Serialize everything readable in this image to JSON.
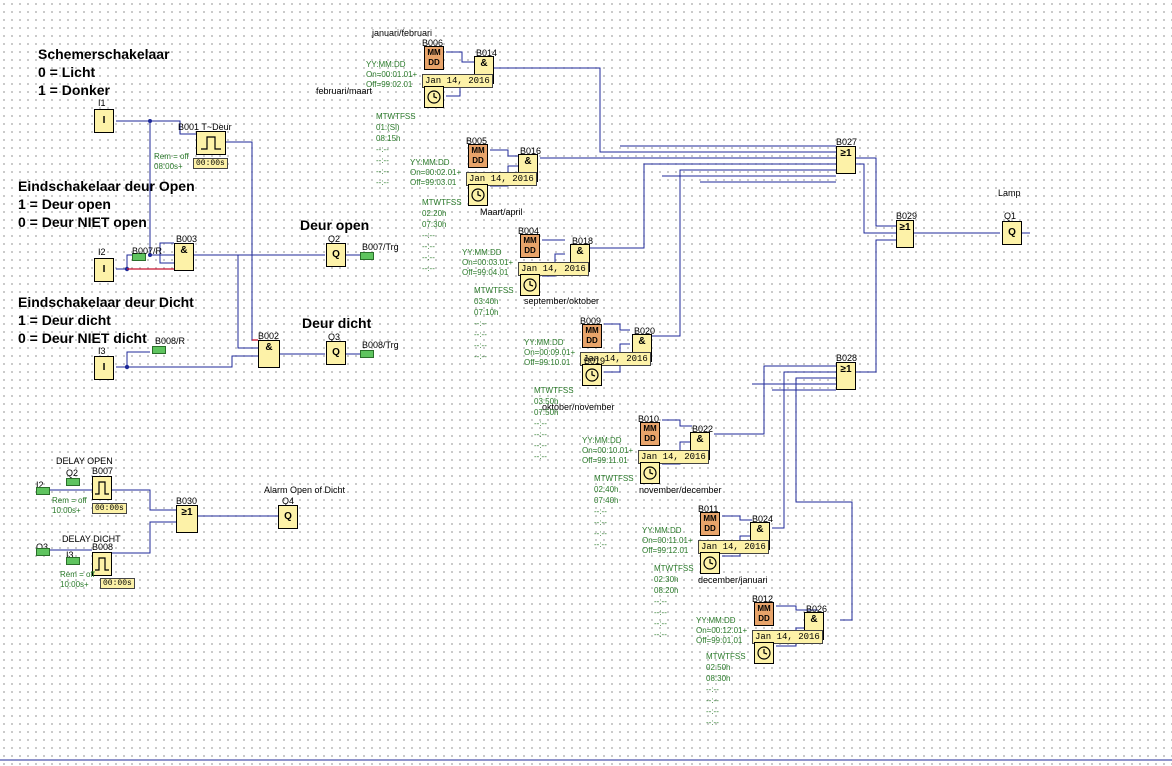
{
  "labels": {
    "schemer_title": "Schemerschakelaar",
    "schemer_0": "0 = Licht",
    "schemer_1": "1 = Donker",
    "open_title": "Eindschakelaar deur Open",
    "open_1": "1 = Deur open",
    "open_0": "0 = Deur NIET open",
    "dicht_title": "Eindschakelaar deur Dicht",
    "dicht_1": "1 = Deur dicht",
    "dicht_0": "0 = Deur NIET dicht",
    "deur_open": "Deur open",
    "deur_dicht": "Deur dicht",
    "delay_open": "DELAY OPEN",
    "delay_dicht": "DELAY DICHT",
    "alarm": "Alarm Open of Dicht",
    "lamp": "Lamp"
  },
  "blocks": {
    "i1": "I1",
    "i2": "I2",
    "i3": "I3",
    "q1": "Q1",
    "q2": "Q2",
    "q3": "Q3",
    "q4": "Q4",
    "b001": "B001 T~Deur",
    "b003": "B003",
    "b002": "B002",
    "b007r": "B007/R",
    "b008r": "B008/R",
    "b007trg": "B007/Trg",
    "b008trg": "B008/Trg",
    "b007": "B007",
    "b008": "B008",
    "b030": "B030",
    "b027": "B027",
    "b028": "B028",
    "b029": "B029",
    "q2_small": "Q2",
    "q3_small": "Q3",
    "i2_small": "I2",
    "i3_small": "I3"
  },
  "symbols": {
    "and": "&",
    "or": "≥1",
    "q": "Q",
    "i": "I",
    "mm": "MM",
    "dd": "DD"
  },
  "rem": {
    "b001": [
      "Rem = off",
      "08:00s+"
    ],
    "b007": [
      "Rem = off",
      "10:00s+"
    ],
    "b008": [
      "Rem = off",
      "10:00s+"
    ],
    "b001_time": "00:00s",
    "b007_time": "00:00s",
    "b008_time": "00:00s"
  },
  "months": [
    {
      "name": "januari/februari",
      "mm": "B006",
      "and": "B014",
      "fmt": "YY:MM:DD",
      "on": "On=00:01.01+",
      "off": "Off=99:02.01",
      "date": "Jan 14, 2016",
      "timer_title": "februari/maart",
      "timer": [
        "MTWTFSS",
        "01:(Sl)",
        "08:15h",
        "--:--",
        "--:--",
        "--:--",
        "--:--"
      ]
    },
    {
      "name": "",
      "mm": "B005",
      "and": "B016",
      "fmt": "YY:MM:DD",
      "on": "On=00:02.01+",
      "off": "Off=99:03.01",
      "date": "Jan 14, 2016",
      "timer_title": "Maart/april",
      "timer": [
        "MTWTFSS",
        "02:20h",
        "07:30h",
        "--:--",
        "--:--",
        "--:--",
        "--:--"
      ]
    },
    {
      "name": "",
      "mm": "B004",
      "and": "B018",
      "fmt": "YY:MM:DD",
      "on": "On=00:03.01+",
      "off": "Off=99:04.01",
      "date": "Jan 14, 2016",
      "timer_title": "september/oktober",
      "timer": [
        "MTWTFSS",
        "03:40h",
        "07:10h",
        "--:--",
        "--:--",
        "--:--",
        "--:--"
      ]
    },
    {
      "name": "",
      "mm": "B009",
      "and": "B020",
      "fmt": "YY:MM:DD",
      "on": "On=00:09.01+",
      "off": "Off=99:10.01",
      "date": "Jan 14, 2016",
      "timer_title": "oktober/november",
      "timer": [
        "MTWTFSS",
        "03:50h",
        "07:50h",
        "--:--",
        "--:--",
        "--:--",
        "--:--"
      ],
      "clk_label": "B019"
    },
    {
      "name": "",
      "mm": "B010",
      "and": "B022",
      "fmt": "YY:MM:DD",
      "on": "On=00:10.01+",
      "off": "Off=99:11.01",
      "date": "Jan 14, 2016",
      "timer_title": "november/december",
      "timer": [
        "MTWTFSS",
        "02:40h",
        "07:40h",
        "--:--",
        "--:--",
        "--:--",
        "--:--"
      ]
    },
    {
      "name": "",
      "mm": "B011",
      "and": "B024",
      "fmt": "YY:MM:DD",
      "on": "On=00:11.01+",
      "off": "Off=99:12.01",
      "date": "Jan 14, 2016",
      "timer_title": "december/januari",
      "timer": [
        "MTWTFSS",
        "02:30h",
        "08:20h",
        "--:--",
        "--:--",
        "--:--",
        "--:--"
      ]
    },
    {
      "name": "",
      "mm": "B012",
      "and": "B026",
      "fmt": "YY:MM:DD",
      "on": "On=00:12.01+",
      "off": "Off=99:01.01",
      "date": "Jan 14, 2016",
      "timer_title": "",
      "timer": [
        "MTWTFSS",
        "02:50h",
        "08:30h",
        "--:--",
        "--:--",
        "--:--",
        "--:--"
      ]
    }
  ]
}
